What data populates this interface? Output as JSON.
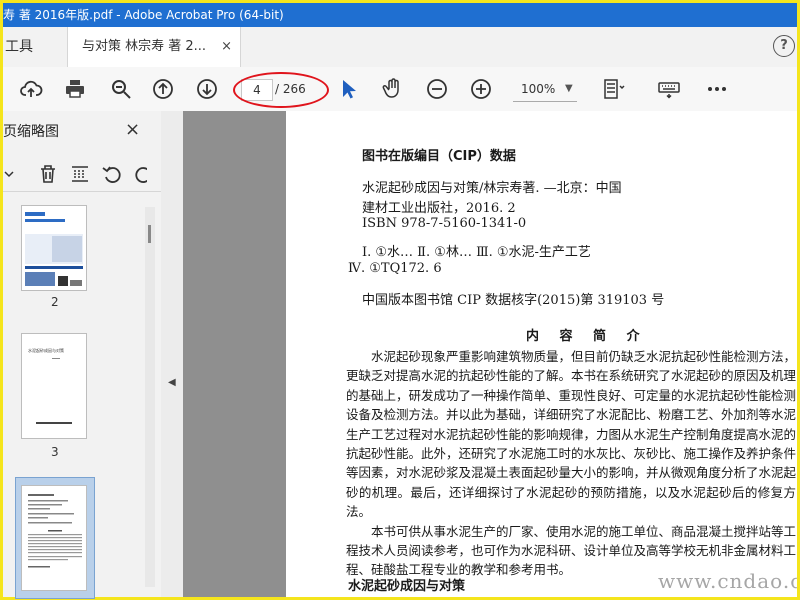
{
  "window": {
    "title": "寿 著 2016年版.pdf - Adobe Acrobat Pro (64-bit)"
  },
  "tabs": {
    "tools_label": "工具",
    "doc_label": "与对策 林宗寿 著 2...",
    "close": "×",
    "help": "?"
  },
  "toolbar": {
    "page_current": "4",
    "page_total": "/ 266",
    "zoom": "100%",
    "icons": [
      "cloud-upload-icon",
      "print-icon",
      "zoom-search-icon",
      "page-up-icon",
      "page-down-icon",
      "select-arrow-icon",
      "hand-icon",
      "zoom-out-icon",
      "zoom-in-icon",
      "fit-page-icon",
      "keyboard-icon",
      "more-icon"
    ]
  },
  "sidebar": {
    "title": "页缩略图",
    "close": "×",
    "thumbnails": [
      {
        "label": "2"
      },
      {
        "label": "3"
      },
      {
        "label": ""
      }
    ],
    "thumb3_text": "水泥起砂成因与对策"
  },
  "page": {
    "cip_title": "图书在版编目（CIP）数据",
    "cip_lines": [
      "水泥起砂成因与对策/林宗寿著. —北京：中国",
      "建材工业出版社，2016. 2",
      "ISBN 978-7-5160-1341-0",
      "Ⅰ. ①水…   Ⅱ. ①林…   Ⅲ. ①水泥-生产工艺",
      "Ⅳ. ①TQ172. 6",
      "中国版本图书馆 CIP 数据核字(2015)第 319103 号"
    ],
    "summary_title": "内 容 简 介",
    "summary_p1": "水泥起砂现象严重影响建筑物质量，但目前仍缺乏水泥抗起砂性能检测方法，更缺乏对提高水泥的抗起砂性能的了解。本书在系统研究了水泥起砂的原因及机理的基础上，研发成功了一种操作简单、重现性良好、可定量的水泥抗起砂性能检测设备及检测方法。并以此为基础，详细研究了水泥配比、粉磨工艺、外加剂等水泥生产工艺过程对水泥抗起砂性能的影响规律，力图从水泥生产控制角度提高水泥的抗起砂性能。此外，还研究了水泥施工时的水灰比、灰砂比、施工操作及养护条件等因素，对水泥砂浆及混凝土表面起砂量大小的影响，并从微观角度分析了水泥起砂的机理。最后，还详细探讨了水泥起砂的预防措施，以及水泥起砂后的修复方法。",
    "summary_p2": "本书可供从事水泥生产的厂家、使用水泥的施工单位、商品混凝土搅拌站等工程技术人员阅读参考，也可作为水泥科研、设计单位及高等学校无机非金属材料工程、硅酸盐工程专业的教学和参考用书。",
    "book_title": "水泥起砂成因与对策",
    "watermark": "www.cndao.com"
  }
}
